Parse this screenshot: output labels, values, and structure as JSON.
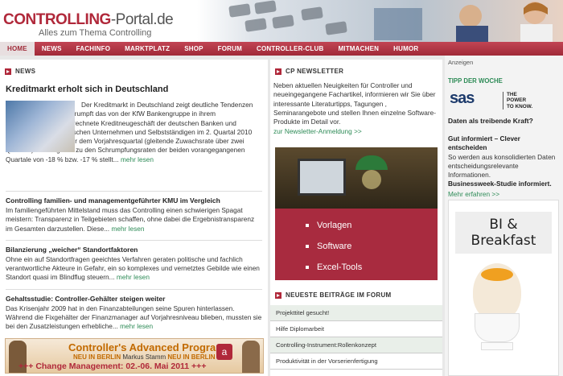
{
  "header": {
    "logo_part1": "CONTROLLING",
    "logo_part2": "-Portal.de",
    "tagline": "Alles zum Thema Controlling"
  },
  "nav": {
    "items": [
      "HOME",
      "NEWS",
      "FACHINFO",
      "MARKTPLATZ",
      "SHOP",
      "FORUM",
      "CONTROLLER-CLUB",
      "MITMACHEN",
      "HUMOR"
    ],
    "active": "HOME"
  },
  "news": {
    "heading": "NEWS",
    "lead_title": "Kreditmarkt erholt sich in Deutschland",
    "lead_text": "Der Kreditmarkt in Deutschland zeigt deutliche Tendenzen der Erholung. Zwar schrumpft das von der KfW Bankengruppe in ihrem Kreditmarktausblick berechnete Kreditneugeschäft der deutschen Banken und Sparkassen mit inländischen Unternehmen und Selbstständigen im 2. Quartal 2010 um rund 8 % gegenüber dem Vorjahresquartal (gleitende Zuwachsrate über zwei Quartale). Im Vergleich zu den Schrumpfungsraten der beiden vorangegangenen Quartale von -18 % bzw. -17 % stellt...",
    "more_label": "mehr lesen",
    "articles": [
      {
        "title": "Controlling familien- und managementgeführter KMU im Vergleich",
        "text": "Im familiengeführten Mittelstand muss das Controlling einen schwierigen Spagat meistern: Transparenz in Teilgebieten schaffen, ohne dabei die Ergebnistransparenz im Gesamten darzustellen. Diese..."
      },
      {
        "title": "Bilanzierung „weicher“ Standortfaktoren",
        "text": "Ohne ein auf Standortfragen geeichtes Verfahren geraten politische und fachlich verantwortliche Akteure in Gefahr, ein so komplexes und vernetztes Gebilde wie einen Standort quasi im Blindflug steuern..."
      },
      {
        "title": "Gehaltsstudie: Controller-Gehälter steigen weiter",
        "text": "Das Krisenjahr 2009 hat in den Finanzabteilungen seine Spuren hinterlassen. Während die Fixgehälter der Finanzmanager auf Vorjahresniveau blieben, mussten sie bei den Zusatzleistungen erhebliche..."
      }
    ]
  },
  "banner_left": {
    "title": "Controller's Advanced Program",
    "sub_prefix": "NEU IN BERLIN",
    "sub_name": "Markus Stamm",
    "sub_suffix": "NEU IN BERLIN",
    "change": "+++ Change Management: 02.-06. Mai 2011 +++"
  },
  "newsletter": {
    "heading": "CP NEWSLETTER",
    "text": "Neben aktuellen Neuigkeiten für Controller und neueingegangene Fachartikel, informieren wir Sie über interessante Literaturtipps, Tagungen , Seminarangebote und stellen Ihnen einzelne Software- Produkte im Detail vor.",
    "link": "zur Newsletter-Anmeldung >>"
  },
  "promo": {
    "items": [
      "Vorlagen",
      "Software",
      "Excel-Tools"
    ]
  },
  "forum": {
    "heading": "NEUESTE BEITRÄGE IM FORUM",
    "items": [
      "Projekttitel gesucht!",
      "Hilfe Diplomarbeit",
      "Controlling-Instrument:Rollenkonzept",
      "Produktivität in der Vorserienfertigung"
    ]
  },
  "right": {
    "ad_label": "Anzeigen",
    "tipp_heading": "TIPP DER WOCHE",
    "sas_logo": "sas",
    "sas_tagline_1": "THE",
    "sas_tagline_2": "POWER",
    "sas_tagline_3": "TO KNOW.",
    "question": "Daten als treibende Kraft?",
    "text_bold": "Gut informiert – Clever entscheiden",
    "text_body": "So werden aus konsolidierten Daten entscheidungsrelevante Informationen.",
    "text_bold2": "Businessweek-Studie informiert.",
    "link": "Mehr erfahren >>",
    "bi_title": "BI & Breakfast"
  }
}
